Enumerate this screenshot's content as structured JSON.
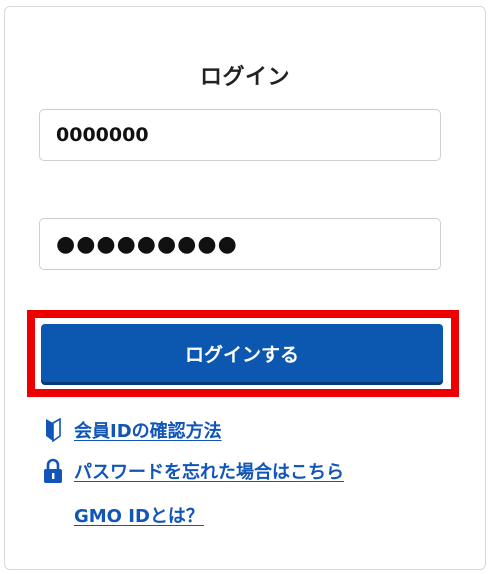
{
  "login": {
    "title": "ログイン",
    "member_id_value": "0000000",
    "password_display": "●●●●●●●●●",
    "submit_label": "ログインする"
  },
  "links": [
    {
      "label": "会員IDの確認方法",
      "icon": "beginner-mark-icon"
    },
    {
      "label": "パスワードを忘れた場合はこちら",
      "icon": "lock-icon"
    },
    {
      "label": "GMO IDとは？"
    }
  ],
  "colors": {
    "primary_button": "#0c57b0",
    "link": "#1155b8",
    "highlight_border": "#ee0000"
  }
}
